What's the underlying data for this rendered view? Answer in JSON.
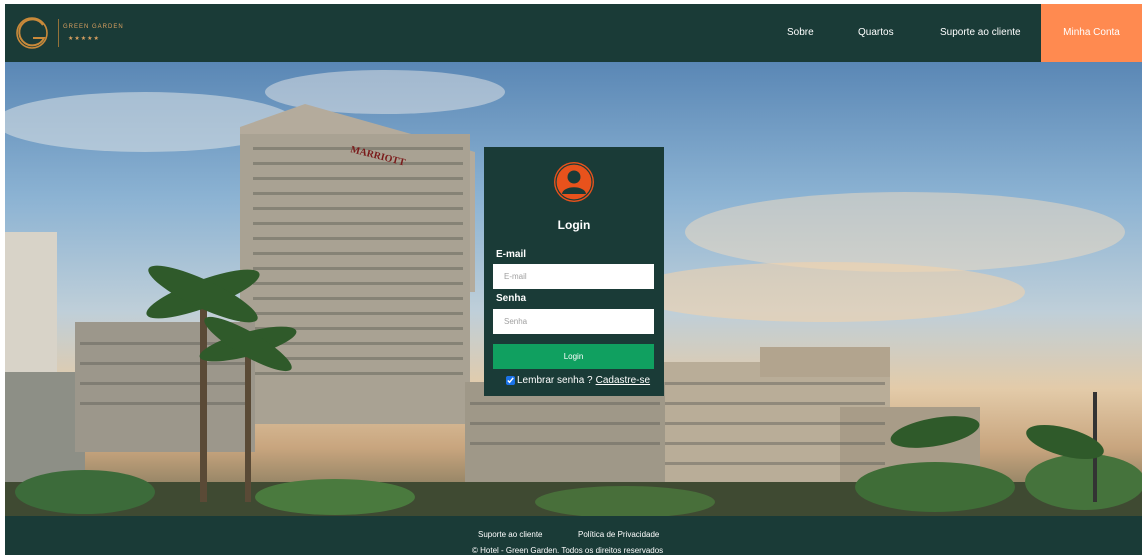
{
  "brand": {
    "name": "GREEN GARDEN",
    "stars": "★★★★★",
    "logo_letter": "G",
    "accent": "#c98a3a"
  },
  "nav": {
    "items": [
      {
        "label": "Sobre"
      },
      {
        "label": "Quartos"
      },
      {
        "label": "Suporte ao cliente"
      }
    ],
    "account_label": "Minha Conta"
  },
  "hero": {
    "hotel_sign": "MARRIOTT"
  },
  "login": {
    "avatar_icon": "user-icon",
    "title": "Login",
    "email_label": "E-mail",
    "email_placeholder": "E-mail",
    "email_value": "",
    "password_label": "Senha",
    "password_placeholder": "Senha",
    "password_value": "",
    "submit_label": "Login",
    "remember_label": "Lembrar senha ?",
    "remember_checked": true,
    "signup_label": "Cadastre-se"
  },
  "footer": {
    "links": [
      {
        "label": "Suporte ao cliente"
      },
      {
        "label": "Política de Privacidade"
      }
    ],
    "copyright": "© Hotel - Green Garden. Todos os direitos reservados"
  },
  "colors": {
    "primary": "#1a3b37",
    "account_button": "#ff8a50",
    "login_button": "#10a060",
    "avatar": "#e8521c"
  }
}
